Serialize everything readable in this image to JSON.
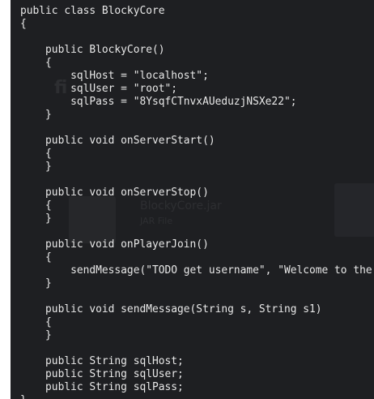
{
  "background_ghost": {
    "title": "fi",
    "item_label": "BlockyCore.jar",
    "item_sub": "JAR File"
  },
  "code_lines": [
    "public class BlockyCore",
    "{",
    "",
    "    public BlockyCore()",
    "    {",
    "        sqlHost = \"localhost\";",
    "        sqlUser = \"root\";",
    "        sqlPass = \"8YsqfCTnvxAUeduzjNSXe22\";",
    "    }",
    "",
    "    public void onServerStart()",
    "    {",
    "    }",
    "",
    "    public void onServerStop()",
    "    {",
    "    }",
    "",
    "    public void onPlayerJoin()",
    "    {",
    "        sendMessage(\"TODO get username\", \"Welcome to the BlockyCraft!!!!!!!\");",
    "    }",
    "",
    "    public void sendMessage(String s, String s1)",
    "    {",
    "    }",
    "",
    "    public String sqlHost;",
    "    public String sqlUser;",
    "    public String sqlPass;",
    "}"
  ],
  "colors": {
    "editor_background": "#1e1f22",
    "code_text": "#e8e8e8",
    "page_background": "#ffffff"
  }
}
